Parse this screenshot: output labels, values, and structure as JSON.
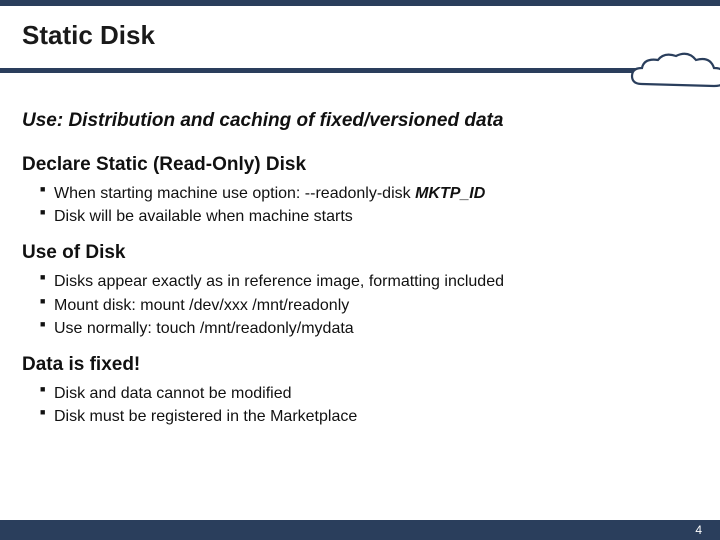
{
  "title": "Static Disk",
  "use_line": "Use: Distribution and caching of fixed/versioned data",
  "sections": [
    {
      "heading": "Declare Static (Read-Only) Disk",
      "items": [
        {
          "prefix": "When starting machine use option:  --readonly-disk ",
          "bold": "MKTP_ID"
        },
        {
          "prefix": "Disk will be available when machine starts",
          "bold": ""
        }
      ]
    },
    {
      "heading": "Use of Disk",
      "items": [
        {
          "prefix": "Disks appear exactly as in reference image, formatting included",
          "bold": ""
        },
        {
          "prefix": "Mount disk:  mount /dev/xxx /mnt/readonly",
          "bold": ""
        },
        {
          "prefix": "Use normally:  touch /mnt/readonly/mydata",
          "bold": ""
        }
      ]
    },
    {
      "heading": "Data is fixed!",
      "items": [
        {
          "prefix": "Disk and data cannot be modified",
          "bold": ""
        },
        {
          "prefix": "Disk must be registered in the Marketplace",
          "bold": ""
        }
      ]
    }
  ],
  "page_number": "4"
}
